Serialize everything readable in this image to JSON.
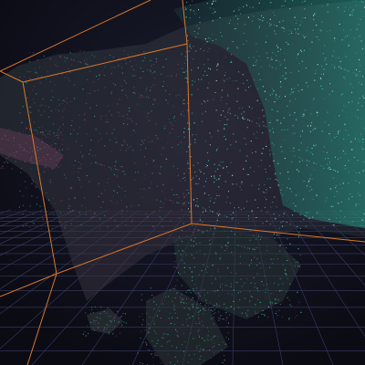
{
  "viewer": {
    "background_color": "#0b0b14",
    "grid_color": "#3a3c66",
    "bounding_box_color": "#d9772a",
    "point_colors": [
      "#3fd6b8",
      "#2fa58f",
      "#6ee7d0",
      "#7b5a8c",
      "#8a4a6a",
      "#c7f5e8"
    ]
  }
}
